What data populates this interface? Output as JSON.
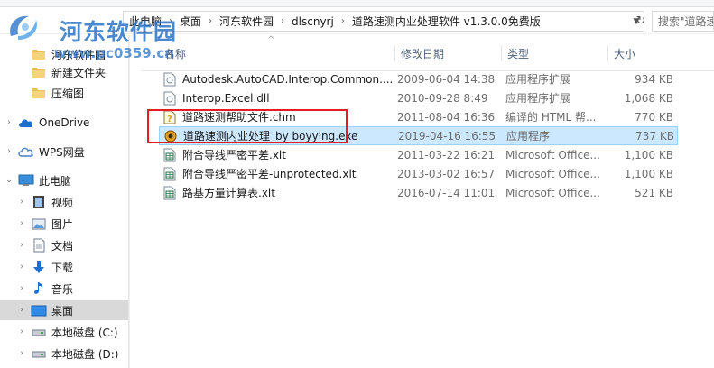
{
  "watermark": {
    "title": "河东软件园",
    "url": "www.pc0359.cn"
  },
  "address_bar": {
    "crumbs": [
      "此电脑",
      "桌面",
      "河东软件园",
      "dlscnyrj",
      "道路速测内业处理软件 v1.3.0.0免费版"
    ]
  },
  "search": {
    "placeholder": "搜索\"道路速"
  },
  "nav": {
    "items": [
      {
        "label": "河东软件园",
        "icon": "folder-icon"
      },
      {
        "label": "新建文件夹",
        "icon": "folder-icon"
      },
      {
        "label": "压缩图",
        "icon": "folder-icon"
      },
      {
        "label": "OneDrive",
        "icon": "cloud-icon"
      },
      {
        "label": "WPS网盘",
        "icon": "cloud-icon"
      },
      {
        "label": "此电脑",
        "icon": "computer-icon"
      },
      {
        "label": "视频",
        "icon": "video-icon"
      },
      {
        "label": "图片",
        "icon": "picture-icon"
      },
      {
        "label": "文档",
        "icon": "document-icon"
      },
      {
        "label": "下载",
        "icon": "download-icon"
      },
      {
        "label": "音乐",
        "icon": "music-icon"
      },
      {
        "label": "桌面",
        "icon": "desktop-icon"
      },
      {
        "label": "本地磁盘 (C:)",
        "icon": "drive-icon"
      },
      {
        "label": "本地磁盘 (D:)",
        "icon": "drive-icon"
      }
    ]
  },
  "columns": {
    "name": "名称",
    "date": "修改日期",
    "type": "类型",
    "size": "大小"
  },
  "files": [
    {
      "name": "Autodesk.AutoCAD.Interop.Common....",
      "date": "2009-06-04 14:38",
      "type": "应用程序扩展",
      "size": "934 KB",
      "icon": "dll-icon"
    },
    {
      "name": "Interop.Excel.dll",
      "date": "2010-09-28 8:49",
      "type": "应用程序扩展",
      "size": "1,068 KB",
      "icon": "dll-icon"
    },
    {
      "name": "道路速测帮助文件.chm",
      "date": "2011-08-04 16:36",
      "type": "编译的 HTML 帮...",
      "size": "770 KB",
      "icon": "chm-help-icon"
    },
    {
      "name": "道路速测内业处理_by boyying.exe",
      "date": "2019-04-16 16:55",
      "type": "应用程序",
      "size": "737 KB",
      "icon": "exe-gear-icon"
    },
    {
      "name": "附合导线严密平差.xlt",
      "date": "2011-03-22 16:21",
      "type": "Microsoft Office...",
      "size": "1,100 KB",
      "icon": "excel-template-icon"
    },
    {
      "name": "附合导线严密平差-unprotected.xlt",
      "date": "2013-03-02 16:57",
      "type": "Microsoft Office...",
      "size": "1,100 KB",
      "icon": "excel-template-icon"
    },
    {
      "name": "路基方量计算表.xlt",
      "date": "2016-07-14 11:01",
      "type": "Microsoft Office...",
      "size": "521 KB",
      "icon": "excel-template-icon"
    }
  ]
}
